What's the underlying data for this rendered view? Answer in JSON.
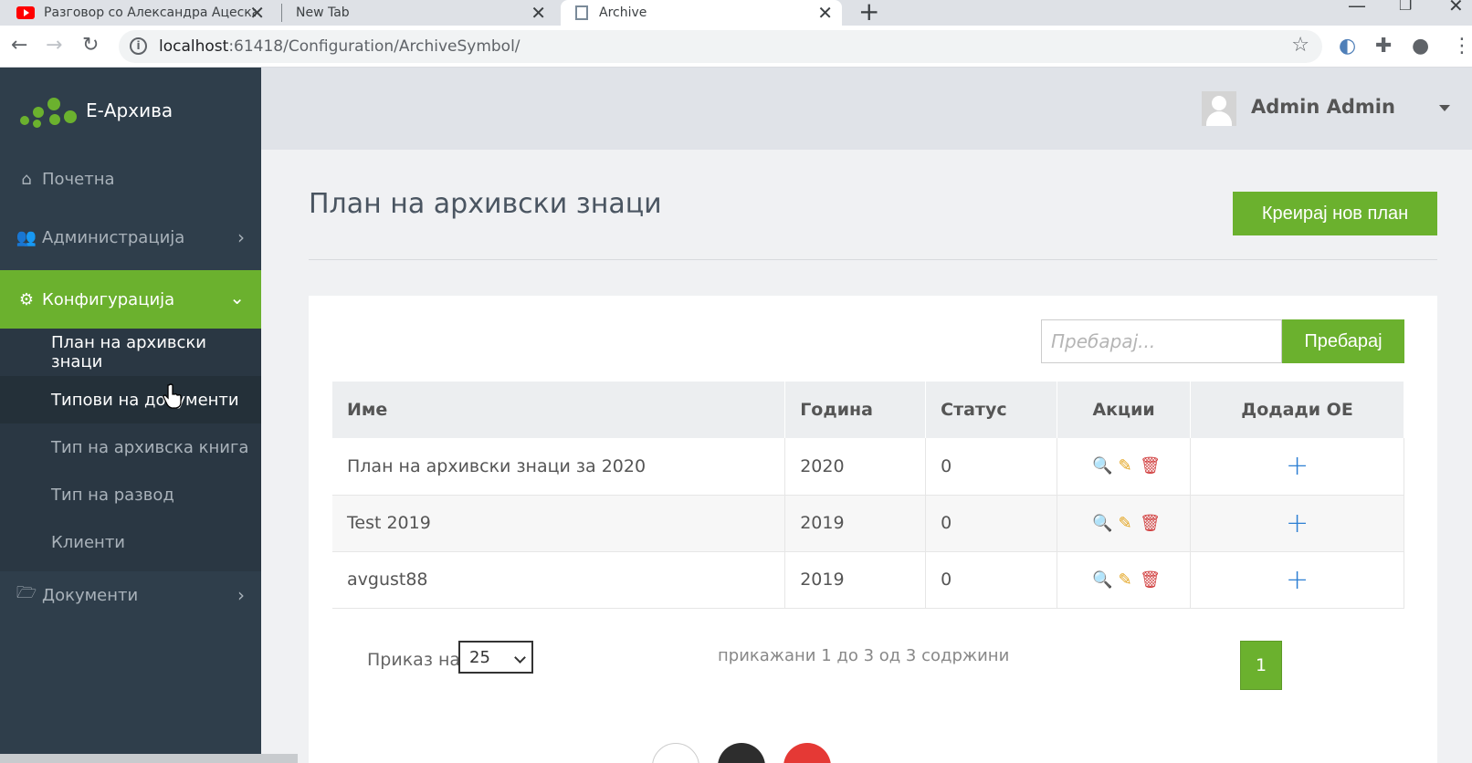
{
  "browser": {
    "tabs": [
      {
        "title": "Разговор со Александра Ацеска"
      },
      {
        "title": "New Tab"
      },
      {
        "title": "Archive"
      }
    ],
    "url_host": "localhost",
    "url_path": ":61418/Configuration/ArchiveSymbol/"
  },
  "sidebar": {
    "brand": "E-Архива",
    "items": [
      {
        "label": "Почетна",
        "icon": "home-icon"
      },
      {
        "label": "Администрација",
        "icon": "users-icon"
      },
      {
        "label": "Конфигурација",
        "icon": "gears-icon"
      },
      {
        "label": "Документи",
        "icon": "folder-open-icon"
      }
    ],
    "submenu": [
      {
        "label": "План на архивски знаци"
      },
      {
        "label": "Типови на документи"
      },
      {
        "label": "Тип на архивска книга"
      },
      {
        "label": "Тип на развод"
      },
      {
        "label": "Клиенти"
      }
    ]
  },
  "header": {
    "user_name": "Admin Admin"
  },
  "main": {
    "title": "План на архивски знаци",
    "create_button": "Креирај нов план",
    "search_placeholder": "Пребарај...",
    "search_button": "Пребарај",
    "columns": {
      "name": "Име",
      "year": "Година",
      "status": "Статус",
      "actions": "Акции",
      "add": "Додади ОЕ"
    },
    "rows": [
      {
        "name": "План на архивски знаци за 2020",
        "year": "2020",
        "status": "0"
      },
      {
        "name": "Test 2019",
        "year": "2019",
        "status": "0"
      },
      {
        "name": "avgust88",
        "year": "2019",
        "status": "0"
      }
    ],
    "show_label": "Приказ на",
    "page_size": "25",
    "info": "прикажани 1 до 3 од 3 содржини",
    "current_page": "1"
  },
  "colors": {
    "accent": "#6bb12e",
    "sidebar_bg": "#2f3e4b",
    "link": "#2d7fd3"
  }
}
